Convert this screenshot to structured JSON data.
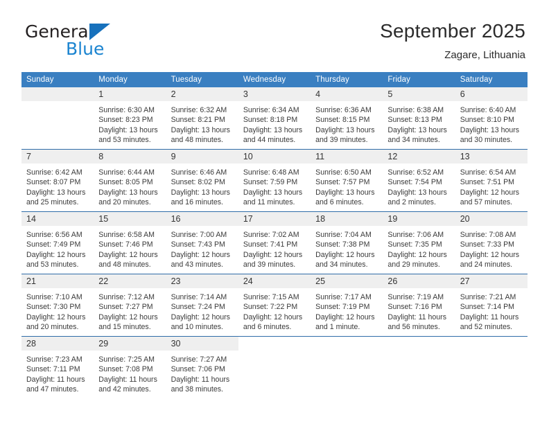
{
  "brand": {
    "name_part1": "General",
    "name_part2": "Blue",
    "logo_icon": "triangle-logo-icon"
  },
  "header": {
    "title": "September 2025",
    "subtitle": "Zagare, Lithuania"
  },
  "colors": {
    "header_blue": "#3a7fc1",
    "row_divider_blue": "#2e6ca8",
    "daynum_band": "#efefef",
    "brand_blue": "#1b84d0",
    "text": "#333333"
  },
  "weekday_headers": [
    "Sunday",
    "Monday",
    "Tuesday",
    "Wednesday",
    "Thursday",
    "Friday",
    "Saturday"
  ],
  "labels": {
    "sunrise_prefix": "Sunrise:",
    "sunset_prefix": "Sunset:",
    "daylight_prefix": "Daylight:"
  },
  "weeks": [
    [
      {
        "day": "",
        "empty": true
      },
      {
        "day": "1",
        "sunrise": "Sunrise: 6:30 AM",
        "sunset": "Sunset: 8:23 PM",
        "daylight1": "Daylight: 13 hours",
        "daylight2": "and 53 minutes."
      },
      {
        "day": "2",
        "sunrise": "Sunrise: 6:32 AM",
        "sunset": "Sunset: 8:21 PM",
        "daylight1": "Daylight: 13 hours",
        "daylight2": "and 48 minutes."
      },
      {
        "day": "3",
        "sunrise": "Sunrise: 6:34 AM",
        "sunset": "Sunset: 8:18 PM",
        "daylight1": "Daylight: 13 hours",
        "daylight2": "and 44 minutes."
      },
      {
        "day": "4",
        "sunrise": "Sunrise: 6:36 AM",
        "sunset": "Sunset: 8:15 PM",
        "daylight1": "Daylight: 13 hours",
        "daylight2": "and 39 minutes."
      },
      {
        "day": "5",
        "sunrise": "Sunrise: 6:38 AM",
        "sunset": "Sunset: 8:13 PM",
        "daylight1": "Daylight: 13 hours",
        "daylight2": "and 34 minutes."
      },
      {
        "day": "6",
        "sunrise": "Sunrise: 6:40 AM",
        "sunset": "Sunset: 8:10 PM",
        "daylight1": "Daylight: 13 hours",
        "daylight2": "and 30 minutes."
      }
    ],
    [
      {
        "day": "7",
        "sunrise": "Sunrise: 6:42 AM",
        "sunset": "Sunset: 8:07 PM",
        "daylight1": "Daylight: 13 hours",
        "daylight2": "and 25 minutes."
      },
      {
        "day": "8",
        "sunrise": "Sunrise: 6:44 AM",
        "sunset": "Sunset: 8:05 PM",
        "daylight1": "Daylight: 13 hours",
        "daylight2": "and 20 minutes."
      },
      {
        "day": "9",
        "sunrise": "Sunrise: 6:46 AM",
        "sunset": "Sunset: 8:02 PM",
        "daylight1": "Daylight: 13 hours",
        "daylight2": "and 16 minutes."
      },
      {
        "day": "10",
        "sunrise": "Sunrise: 6:48 AM",
        "sunset": "Sunset: 7:59 PM",
        "daylight1": "Daylight: 13 hours",
        "daylight2": "and 11 minutes."
      },
      {
        "day": "11",
        "sunrise": "Sunrise: 6:50 AM",
        "sunset": "Sunset: 7:57 PM",
        "daylight1": "Daylight: 13 hours",
        "daylight2": "and 6 minutes."
      },
      {
        "day": "12",
        "sunrise": "Sunrise: 6:52 AM",
        "sunset": "Sunset: 7:54 PM",
        "daylight1": "Daylight: 13 hours",
        "daylight2": "and 2 minutes."
      },
      {
        "day": "13",
        "sunrise": "Sunrise: 6:54 AM",
        "sunset": "Sunset: 7:51 PM",
        "daylight1": "Daylight: 12 hours",
        "daylight2": "and 57 minutes."
      }
    ],
    [
      {
        "day": "14",
        "sunrise": "Sunrise: 6:56 AM",
        "sunset": "Sunset: 7:49 PM",
        "daylight1": "Daylight: 12 hours",
        "daylight2": "and 53 minutes."
      },
      {
        "day": "15",
        "sunrise": "Sunrise: 6:58 AM",
        "sunset": "Sunset: 7:46 PM",
        "daylight1": "Daylight: 12 hours",
        "daylight2": "and 48 minutes."
      },
      {
        "day": "16",
        "sunrise": "Sunrise: 7:00 AM",
        "sunset": "Sunset: 7:43 PM",
        "daylight1": "Daylight: 12 hours",
        "daylight2": "and 43 minutes."
      },
      {
        "day": "17",
        "sunrise": "Sunrise: 7:02 AM",
        "sunset": "Sunset: 7:41 PM",
        "daylight1": "Daylight: 12 hours",
        "daylight2": "and 39 minutes."
      },
      {
        "day": "18",
        "sunrise": "Sunrise: 7:04 AM",
        "sunset": "Sunset: 7:38 PM",
        "daylight1": "Daylight: 12 hours",
        "daylight2": "and 34 minutes."
      },
      {
        "day": "19",
        "sunrise": "Sunrise: 7:06 AM",
        "sunset": "Sunset: 7:35 PM",
        "daylight1": "Daylight: 12 hours",
        "daylight2": "and 29 minutes."
      },
      {
        "day": "20",
        "sunrise": "Sunrise: 7:08 AM",
        "sunset": "Sunset: 7:33 PM",
        "daylight1": "Daylight: 12 hours",
        "daylight2": "and 24 minutes."
      }
    ],
    [
      {
        "day": "21",
        "sunrise": "Sunrise: 7:10 AM",
        "sunset": "Sunset: 7:30 PM",
        "daylight1": "Daylight: 12 hours",
        "daylight2": "and 20 minutes."
      },
      {
        "day": "22",
        "sunrise": "Sunrise: 7:12 AM",
        "sunset": "Sunset: 7:27 PM",
        "daylight1": "Daylight: 12 hours",
        "daylight2": "and 15 minutes."
      },
      {
        "day": "23",
        "sunrise": "Sunrise: 7:14 AM",
        "sunset": "Sunset: 7:24 PM",
        "daylight1": "Daylight: 12 hours",
        "daylight2": "and 10 minutes."
      },
      {
        "day": "24",
        "sunrise": "Sunrise: 7:15 AM",
        "sunset": "Sunset: 7:22 PM",
        "daylight1": "Daylight: 12 hours",
        "daylight2": "and 6 minutes."
      },
      {
        "day": "25",
        "sunrise": "Sunrise: 7:17 AM",
        "sunset": "Sunset: 7:19 PM",
        "daylight1": "Daylight: 12 hours",
        "daylight2": "and 1 minute."
      },
      {
        "day": "26",
        "sunrise": "Sunrise: 7:19 AM",
        "sunset": "Sunset: 7:16 PM",
        "daylight1": "Daylight: 11 hours",
        "daylight2": "and 56 minutes."
      },
      {
        "day": "27",
        "sunrise": "Sunrise: 7:21 AM",
        "sunset": "Sunset: 7:14 PM",
        "daylight1": "Daylight: 11 hours",
        "daylight2": "and 52 minutes."
      }
    ],
    [
      {
        "day": "28",
        "sunrise": "Sunrise: 7:23 AM",
        "sunset": "Sunset: 7:11 PM",
        "daylight1": "Daylight: 11 hours",
        "daylight2": "and 47 minutes."
      },
      {
        "day": "29",
        "sunrise": "Sunrise: 7:25 AM",
        "sunset": "Sunset: 7:08 PM",
        "daylight1": "Daylight: 11 hours",
        "daylight2": "and 42 minutes."
      },
      {
        "day": "30",
        "sunrise": "Sunrise: 7:27 AM",
        "sunset": "Sunset: 7:06 PM",
        "daylight1": "Daylight: 11 hours",
        "daylight2": "and 38 minutes."
      },
      {
        "day": "",
        "none": true
      },
      {
        "day": "",
        "none": true
      },
      {
        "day": "",
        "none": true
      },
      {
        "day": "",
        "none": true
      }
    ]
  ]
}
